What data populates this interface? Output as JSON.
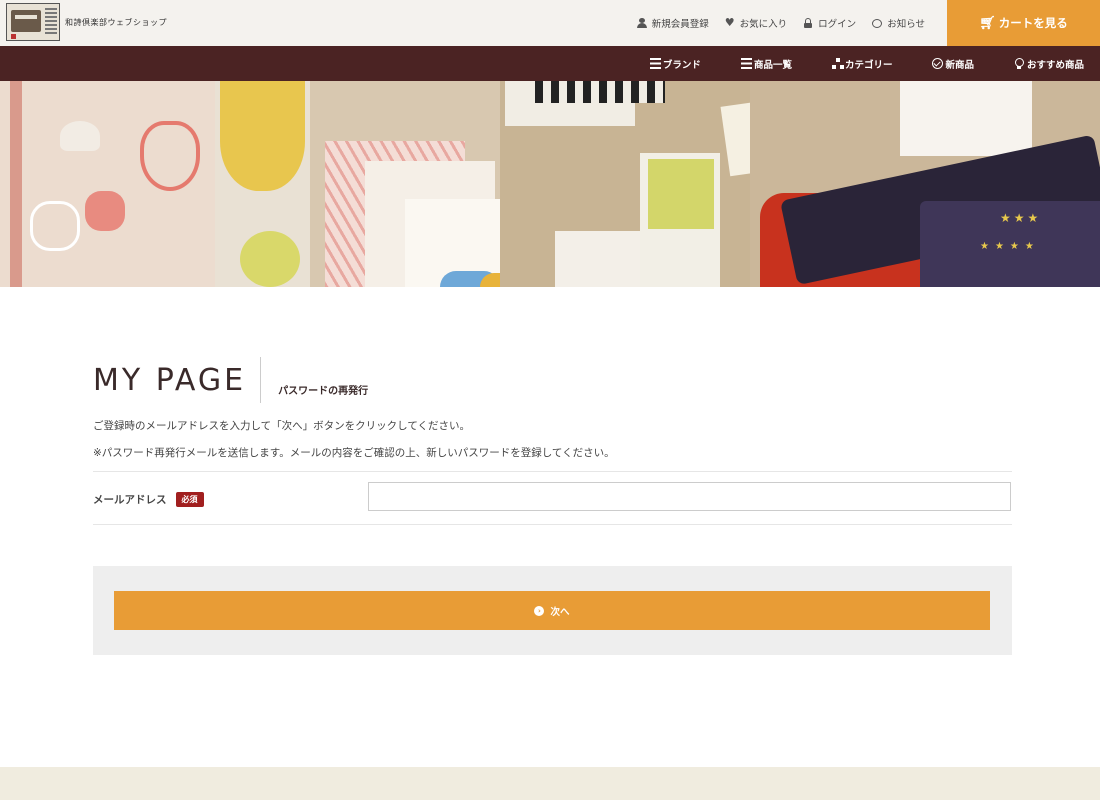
{
  "header": {
    "logo_text": "和詩倶楽部ウェブショップ",
    "links": [
      {
        "label": "新規会員登録",
        "icon": "user-icon"
      },
      {
        "label": "お気に入り",
        "icon": "heart-icon"
      },
      {
        "label": "ログイン",
        "icon": "lock-icon"
      },
      {
        "label": "お知らせ",
        "icon": "speech-bubble-icon"
      }
    ],
    "cart_label": "カートを見る",
    "cart_icon": "cart-icon",
    "accent_color": "#e89c36"
  },
  "nav": {
    "background": "#4b2323",
    "items": [
      {
        "label": "ブランド",
        "icon": "list-icon"
      },
      {
        "label": "商品一覧",
        "icon": "list-icon"
      },
      {
        "label": "カテゴリー",
        "icon": "sitemap-icon"
      },
      {
        "label": "新商品",
        "icon": "check-circle-icon"
      },
      {
        "label": "おすすめ商品",
        "icon": "ribbon-icon"
      }
    ]
  },
  "main": {
    "title": "MY PAGE",
    "subtitle": "パスワードの再発行",
    "instruction": "ご登録時のメールアドレスを入力して「次へ」ボタンをクリックしてください。",
    "note": "※パスワード再発行メールを送信します。メールの内容をご確認の上、新しいパスワードを登録してください。",
    "email_label": "メールアドレス",
    "required_badge": "必須",
    "email_value": "",
    "next_button": "次へ",
    "next_icon": "chevron-right-circle-icon"
  }
}
